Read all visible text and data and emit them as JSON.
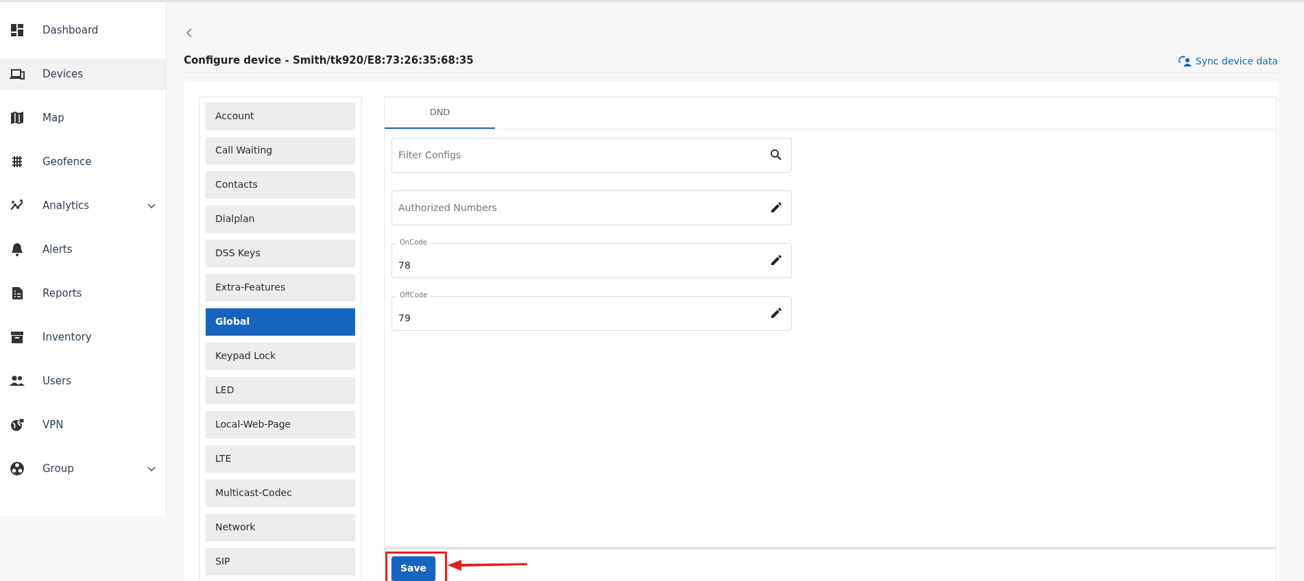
{
  "sidebar": {
    "items": [
      {
        "label": "Dashboard",
        "selected": false,
        "expandable": false
      },
      {
        "label": "Devices",
        "selected": true,
        "expandable": false
      },
      {
        "label": "Map",
        "selected": false,
        "expandable": false
      },
      {
        "label": "Geofence",
        "selected": false,
        "expandable": false
      },
      {
        "label": "Analytics",
        "selected": false,
        "expandable": true
      },
      {
        "label": "Alerts",
        "selected": false,
        "expandable": false
      },
      {
        "label": "Reports",
        "selected": false,
        "expandable": false
      },
      {
        "label": "Inventory",
        "selected": false,
        "expandable": false
      },
      {
        "label": "Users",
        "selected": false,
        "expandable": false
      },
      {
        "label": "VPN",
        "selected": false,
        "expandable": false
      },
      {
        "label": "Group",
        "selected": false,
        "expandable": true
      }
    ]
  },
  "header": {
    "title": "Configure device - Smith/tk920/E8:73:26:35:68:35",
    "sync_link": "Sync device data"
  },
  "config_menu": {
    "items": [
      {
        "label": "Account",
        "selected": false
      },
      {
        "label": "Call Waiting",
        "selected": false
      },
      {
        "label": "Contacts",
        "selected": false
      },
      {
        "label": "Dialplan",
        "selected": false
      },
      {
        "label": "DSS Keys",
        "selected": false
      },
      {
        "label": "Extra-Features",
        "selected": false
      },
      {
        "label": "Global",
        "selected": true
      },
      {
        "label": "Keypad Lock",
        "selected": false
      },
      {
        "label": "LED",
        "selected": false
      },
      {
        "label": "Local-Web-Page",
        "selected": false
      },
      {
        "label": "LTE",
        "selected": false
      },
      {
        "label": "Multicast-Codec",
        "selected": false
      },
      {
        "label": "Network",
        "selected": false
      },
      {
        "label": "SIP",
        "selected": false
      }
    ]
  },
  "tabs": [
    {
      "label": "DND",
      "selected": true
    }
  ],
  "fields": [
    {
      "kind": "search",
      "placeholder": "Filter Configs"
    },
    {
      "kind": "edit",
      "placeholder": "Authorized Numbers"
    },
    {
      "kind": "edit",
      "label": "OnCode",
      "value": "78"
    },
    {
      "kind": "edit",
      "label": "OffCode",
      "value": "79"
    }
  ],
  "save_button": "Save"
}
